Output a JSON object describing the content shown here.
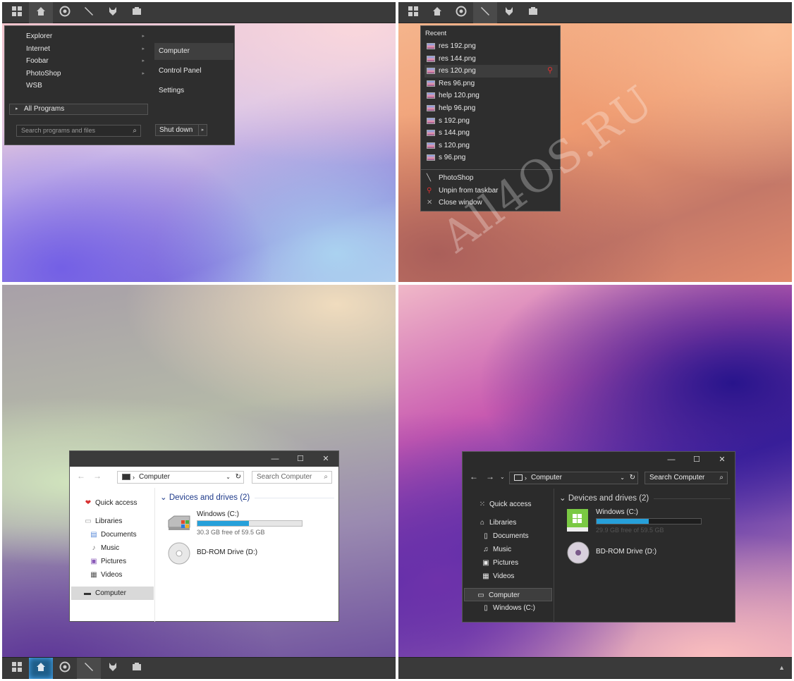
{
  "taskbar_icons": [
    "windows-start-icon",
    "home-icon",
    "chrome-icon",
    "brush-icon",
    "fox-icon",
    "media-icon"
  ],
  "start_menu": {
    "programs": [
      {
        "label": "Explorer"
      },
      {
        "label": "Internet"
      },
      {
        "label": "Foobar"
      },
      {
        "label": "PhotoShop"
      },
      {
        "label": "WSB"
      }
    ],
    "all_programs": "All Programs",
    "search_placeholder": "Search programs and files",
    "right_items": [
      {
        "label": "Computer"
      },
      {
        "label": "Control Panel"
      },
      {
        "label": "Settings"
      }
    ],
    "shutdown": "Shut down"
  },
  "jumplist": {
    "title": "Recent",
    "recent": [
      {
        "label": "res 192.png"
      },
      {
        "label": "res 144.png"
      },
      {
        "label": "res 120.png"
      },
      {
        "label": "Res 96.png"
      },
      {
        "label": "help 120.png"
      },
      {
        "label": "help 96.png"
      },
      {
        "label": "s 192.png"
      },
      {
        "label": "s 144.png"
      },
      {
        "label": "s 120.png"
      },
      {
        "label": "s 96.png"
      }
    ],
    "tasks": [
      {
        "label": "PhotoShop"
      },
      {
        "label": "Unpin from taskbar"
      },
      {
        "label": "Close window"
      }
    ]
  },
  "watermark": "All4OS.RU",
  "explorer_light": {
    "address": "Computer",
    "search": "Search Computer",
    "nav": {
      "quick_access": "Quick access",
      "libraries": "Libraries",
      "documents": "Documents",
      "music": "Music",
      "pictures": "Pictures",
      "videos": "Videos",
      "computer": "Computer"
    },
    "group": "Devices and drives (2)",
    "drives": [
      {
        "name": "Windows (C:)",
        "free": "30.3 GB free of 59.5 GB",
        "used_fraction": 0.49
      },
      {
        "name": "BD-ROM Drive (D:)"
      }
    ]
  },
  "explorer_dark": {
    "address": "Computer",
    "search": "Search Computer",
    "nav": {
      "quick_access": "Quick access",
      "libraries": "Libraries",
      "documents": "Documents",
      "music": "Music",
      "pictures": "Pictures",
      "videos": "Videos",
      "computer": "Computer",
      "windows_c": "Windows (C:)"
    },
    "group": "Devices and drives (2)",
    "drives": [
      {
        "name": "Windows (C:)",
        "free": "29.9 GB free of 59.5 GB",
        "used_fraction": 0.5
      },
      {
        "name": "BD-ROM Drive (D:)"
      }
    ]
  },
  "colors": {
    "taskbar": "#3a3a3a",
    "menu_bg": "#2e2e2e",
    "accent_blue": "#26a0da",
    "pin_red": "#e03030",
    "drive_green": "#7ac943"
  }
}
